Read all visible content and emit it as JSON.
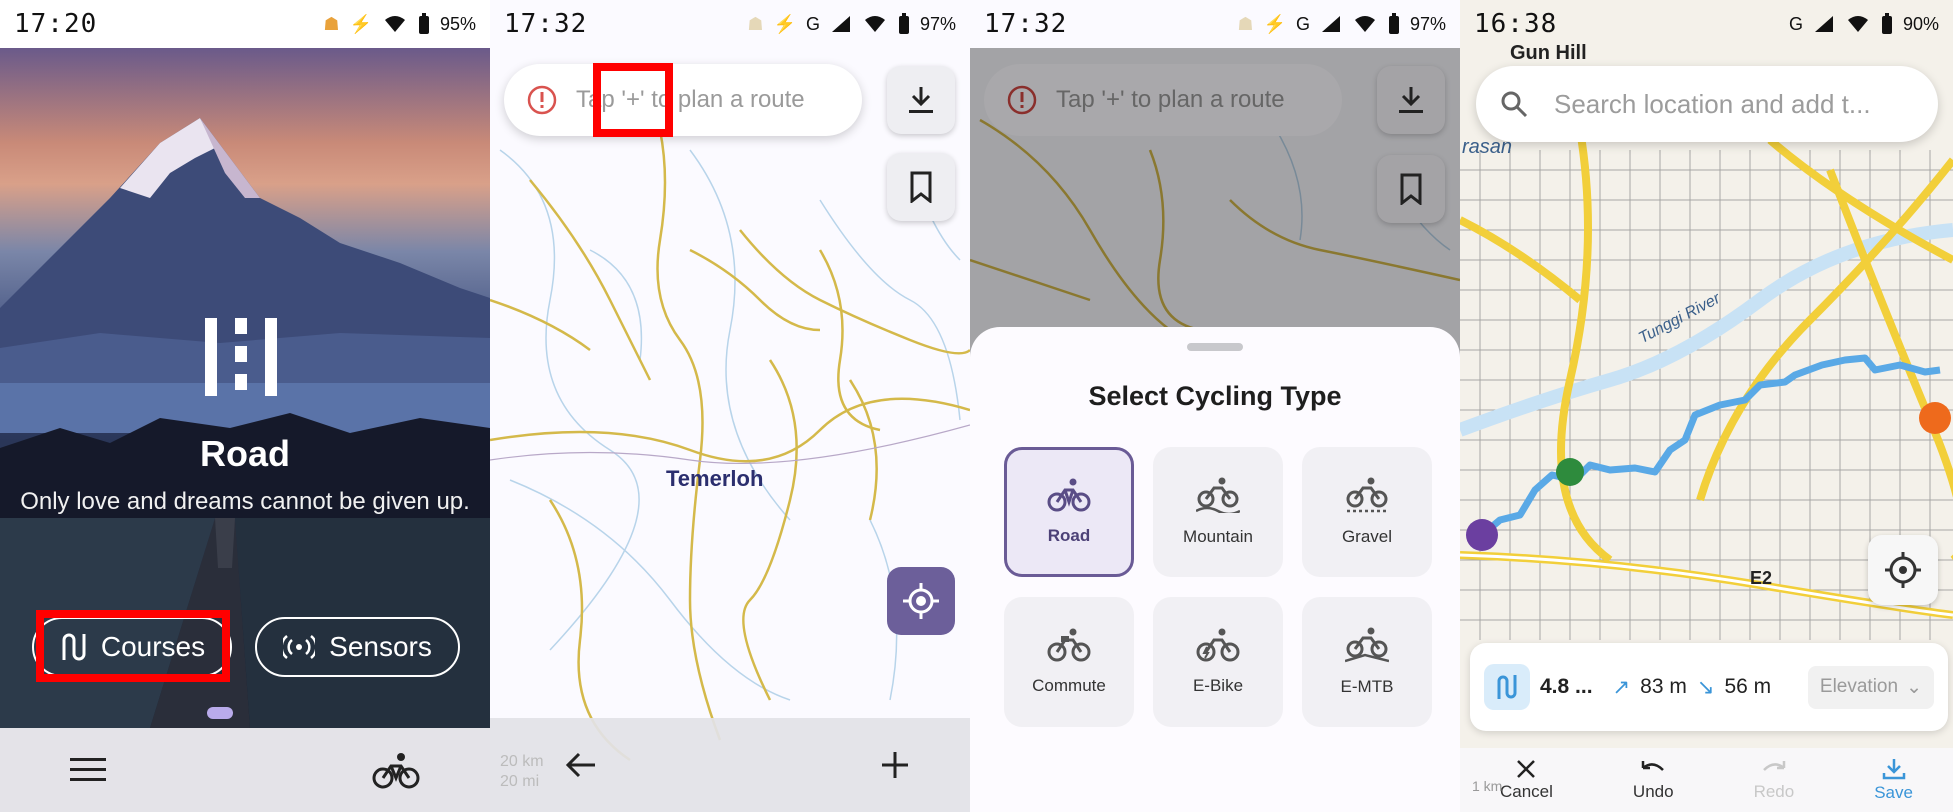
{
  "screen1": {
    "status": {
      "time": "17:20",
      "battery": "95%"
    },
    "brand_title": "Road",
    "tagline": "Only love and dreams cannot be given up.",
    "courses_label": "Courses",
    "sensors_label": "Sensors",
    "icons": [
      "menu-icon",
      "bike-icon",
      "route-icon",
      "sensor-icon"
    ]
  },
  "screen2": {
    "status": {
      "time": "17:32",
      "network": "G",
      "battery": "97%"
    },
    "search_hint": "Tap '+' to plan a route",
    "city": "Temerloh",
    "scale_km": "20 km",
    "scale_mi": "20 mi",
    "icons": [
      "info-icon",
      "download-icon",
      "bookmark-icon",
      "locate-icon",
      "back-arrow-icon",
      "plus-icon"
    ]
  },
  "screen3": {
    "status": {
      "time": "17:32",
      "network": "G",
      "battery": "97%"
    },
    "search_hint": "Tap '+' to plan a route",
    "sheet_title": "Select Cycling Type",
    "types": [
      {
        "label": "Road",
        "selected": true
      },
      {
        "label": "Mountain",
        "selected": false
      },
      {
        "label": "Gravel",
        "selected": false
      },
      {
        "label": "Commute",
        "selected": false
      },
      {
        "label": "E-Bike",
        "selected": false
      },
      {
        "label": "E-MTB",
        "selected": false
      }
    ]
  },
  "screen4": {
    "status": {
      "time": "16:38",
      "network": "G",
      "battery": "90%"
    },
    "search_placeholder": "Search location and add t...",
    "map_label_top": "Gun Hill",
    "map_label_left": "rasan",
    "river_label": "Tunggi River",
    "road_label": "E2",
    "distance": "4.8 ...",
    "ascent": "83 m",
    "descent": "56 m",
    "elevation_select": "Elevation",
    "scale": "1 km",
    "actions": [
      "Cancel",
      "Undo",
      "Redo",
      "Save"
    ],
    "route_color": "#5aa9e6"
  },
  "accent": "#6a5b96"
}
